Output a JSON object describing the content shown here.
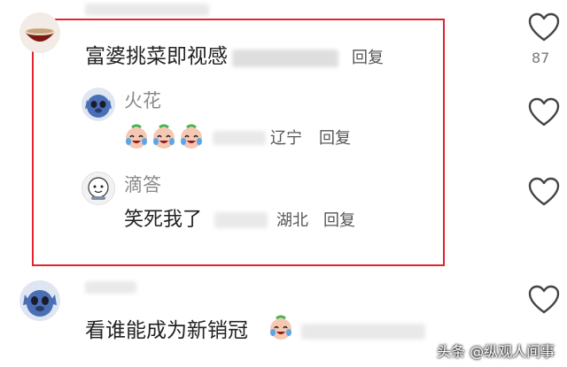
{
  "comments": [
    {
      "text": "富婆挑菜即视感",
      "reply_label": "回复",
      "like_count": "87",
      "replies": [
        {
          "username": "火花",
          "text": "",
          "emoji_count": 3,
          "location": "辽宁",
          "reply_label": "回复"
        },
        {
          "username": "滴答",
          "text": "笑死我了",
          "location": "湖北",
          "reply_label": "回复"
        }
      ]
    },
    {
      "text": "看谁能成为新销冠"
    }
  ],
  "watermark": "头条 @纵观人间事",
  "colors": {
    "highlight_border": "#e2242d",
    "name_gray": "#8a8a8a"
  },
  "icons": [
    "heart-outline-icon",
    "crying-laugh-emoji",
    "bowl-avatar",
    "stitch-avatar",
    "cartoon-avatar"
  ]
}
